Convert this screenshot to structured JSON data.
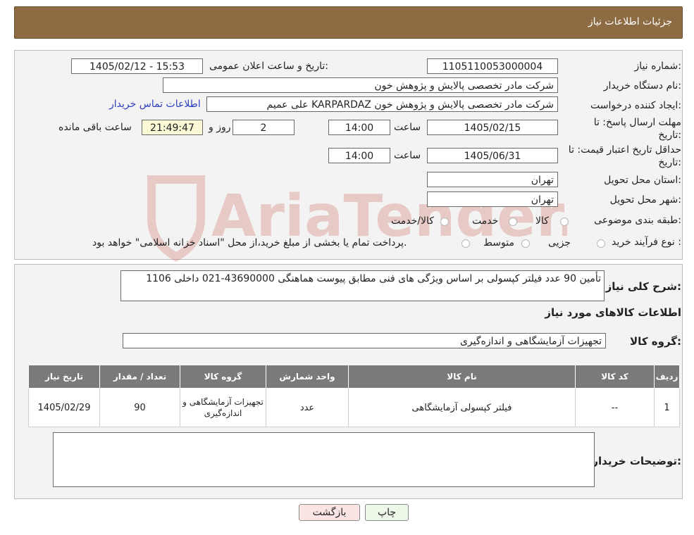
{
  "header": {
    "title": "جزئیات اطلاعات نیاز"
  },
  "form": {
    "need_number_label": "شماره نیاز:",
    "need_number": "1105110053000004",
    "announce_label": "تاریخ و ساعت اعلان عمومی:",
    "announce_value": "1405/02/12 - 15:53",
    "buyer_org_label": "نام دستگاه خریدار:",
    "buyer_org": "شرکت مادر تخصصی پالایش و پژوهش خون",
    "requester_label": "ایجاد کننده درخواست:",
    "requester": "علی عمیم KARPARDAZ شرکت مادر تخصصی پالایش و پژوهش خون",
    "contact_link": "اطلاعات تماس خریدار",
    "deadline_label_1": "مهلت ارسال پاسخ: تا",
    "deadline_label_2": "تاریخ:",
    "deadline_date": "1405/02/15",
    "time_label": "ساعت",
    "deadline_time": "14:00",
    "days_value": "2",
    "days_label": "روز و",
    "remaining_time": "21:49:47",
    "remaining_label": "ساعت باقی مانده",
    "validity_label_1": "حداقل تاریخ اعتبار قیمت: تا",
    "validity_label_2": "تاریخ:",
    "validity_date": "1405/06/31",
    "validity_time": "14:00",
    "province_label": "استان محل تحویل:",
    "province": "تهران",
    "city_label": "شهر محل تحویل:",
    "city": "تهران",
    "category_label": "طبقه بندی موضوعی:",
    "category_options": [
      "کالا",
      "خدمت",
      "کالا/خدمت"
    ],
    "process_label": "نوع فرآیند خرید :",
    "process_options": [
      "جزیی",
      "متوسط"
    ],
    "process_note": "پرداخت تمام یا بخشی از مبلغ خرید،از محل \"اسناد خزانه اسلامی\" خواهد بود."
  },
  "description": {
    "label": "شرح کلی نیاز:",
    "text": "تأمین 90 عدد فیلتر کپسولی بر اساس ویژگی های فنی مطابق پیوست هماهنگی 43690000-021 داخلی 1106"
  },
  "goods": {
    "section_title": "اطلاعات کالاهای مورد نیاز",
    "group_label": "گروه کالا:",
    "group_value": "تجهیزات آزمایشگاهی و اندازه‌گیری"
  },
  "table": {
    "headers": [
      "ردیف",
      "کد کالا",
      "نام کالا",
      "واحد شمارش",
      "گروه کالا",
      "تعداد / مقدار",
      "تاریخ نیاز"
    ],
    "rows": [
      {
        "row": "1",
        "code": "--",
        "name": "فیلتر کپسولی آزمایشگاهی",
        "unit": "عدد",
        "group": "تجهیزات آزمایشگاهی و اندازه‌گیری",
        "qty": "90",
        "date": "1405/02/29"
      }
    ]
  },
  "buyer_notes": {
    "label": "توضیحات خریدار:",
    "value": ""
  },
  "buttons": {
    "print": "چاپ",
    "back": "بازگشت"
  },
  "watermark": {
    "text": "AriaTender.neT",
    "color": "#c0392b"
  }
}
